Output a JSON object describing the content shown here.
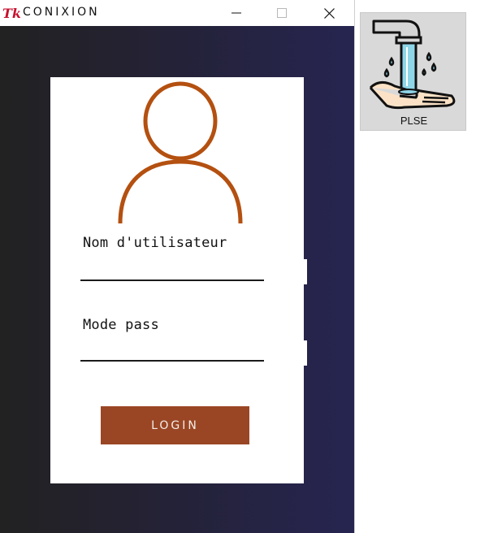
{
  "window": {
    "title": "CONIXION",
    "logo_text": "Tk",
    "controls": [
      "minimize",
      "maximize",
      "close"
    ]
  },
  "login_form": {
    "username_label": "Nom d'utilisateur",
    "username_value": "",
    "password_label": "Mode pass",
    "password_value": "",
    "login_button": "LOGIN",
    "avatar_icon": "user-silhouette-icon"
  },
  "desktop": {
    "shortcut_label": "PLSE",
    "shortcut_icon": "hand-washing-icon"
  },
  "colors": {
    "button": "#9a4625",
    "avatar_outline": "#b45010",
    "background_left": "#222222",
    "background_right": "#262551"
  }
}
